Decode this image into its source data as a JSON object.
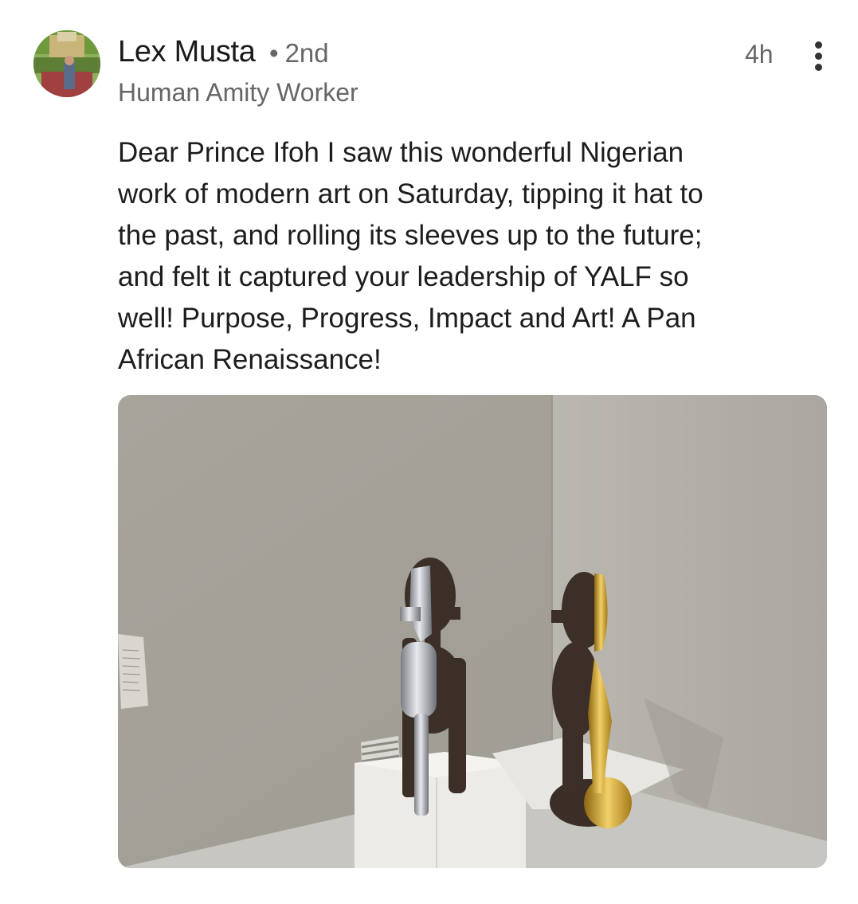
{
  "post": {
    "author": {
      "name": "Lex Musta",
      "degree_separator": "•",
      "degree": "2nd",
      "headline": "Human Amity Worker",
      "avatar_icon": "profile-photo-garden"
    },
    "time_ago": "4h",
    "more_icon": "vertical-ellipsis-icon",
    "text_lines": [
      "Dear Prince Ifoh I saw this wonderful Nigerian",
      "work of modern art on Saturday, tipping it hat to",
      "the past, and rolling its sleeves up to the future;",
      "and felt it captured your leadership of YALF so",
      "well! Purpose, Progress, Impact and Art! A Pan",
      "African Renaissance!"
    ],
    "image": {
      "subject": "two sculptures on white plinths in a gallery corner",
      "colors": {
        "wall_left": "#a9a69e",
        "wall_right": "#b2b0a8",
        "plinth": "#e9e8e3",
        "wood": "#3b2f27",
        "silver": "#c9ccd0",
        "gold": "#d4a82a"
      }
    }
  }
}
